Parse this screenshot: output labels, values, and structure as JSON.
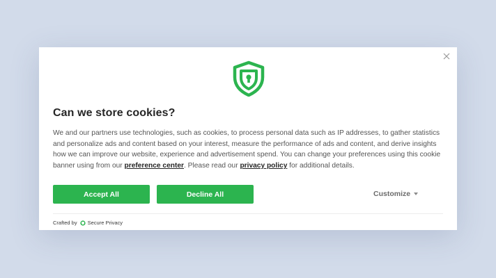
{
  "banner": {
    "title": "Can we store cookies?",
    "text_before_pref": "We and our partners use technologies, such as cookies, to process personal data such as IP addresses, to gather statistics and personalize ads and content based on your interest, measure the performance of ads and content, and derive insights how we can improve our website, experience and advertisement spend. You can change your preferences using this cookie banner using from our ",
    "preference_center_link": "preference center",
    "text_between": ". Please read our ",
    "privacy_policy_link": "privacy policy",
    "text_after": " for additional details.",
    "logo_icon": "shield-lock-icon",
    "close_icon": "close-icon"
  },
  "buttons": {
    "accept": "Accept All",
    "decline": "Decline All",
    "customize": "Customize"
  },
  "footer": {
    "crafted_by": "Crafted by",
    "brand": "Secure Privacy"
  },
  "colors": {
    "brand_green": "#2cb44f",
    "backdrop": "#d2dbea",
    "title": "#262626",
    "body_text": "#555555"
  }
}
